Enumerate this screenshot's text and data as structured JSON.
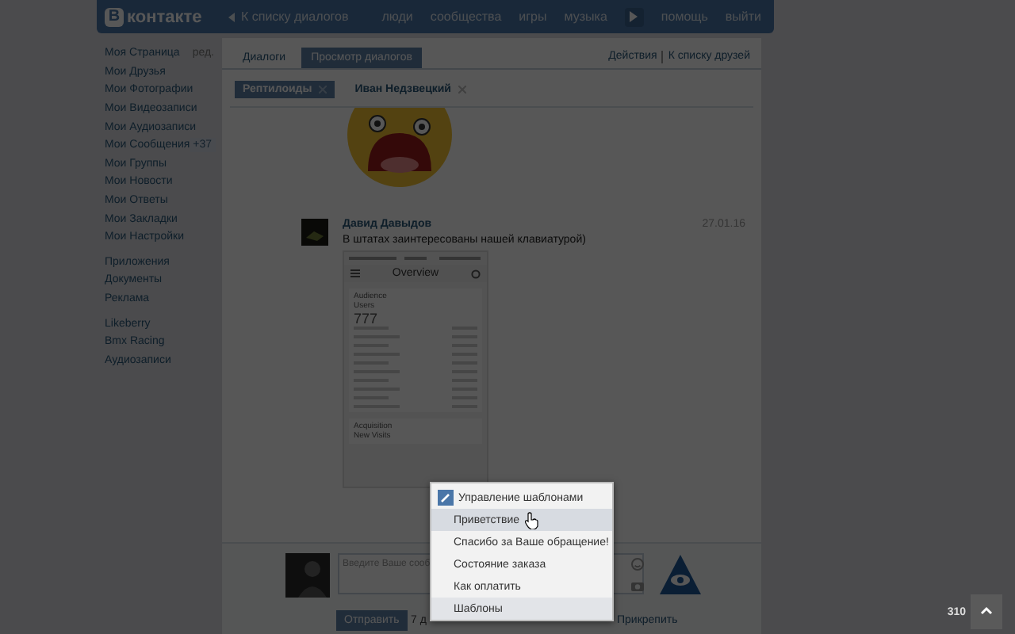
{
  "header": {
    "logo_mark": "В",
    "logo_text": "контакте",
    "back_link": "К списку диалогов",
    "nav": [
      {
        "kind": "link",
        "label": "люди"
      },
      {
        "kind": "link",
        "label": "сообщества"
      },
      {
        "kind": "link",
        "label": "игры"
      },
      {
        "kind": "link",
        "label": "музыка"
      },
      {
        "kind": "player"
      },
      {
        "kind": "link",
        "label": "помощь"
      },
      {
        "kind": "link",
        "label": "выйти"
      }
    ]
  },
  "sidebar": {
    "groups": [
      [
        {
          "label": "Моя Страница",
          "action": "ред."
        },
        {
          "label": "Мои Друзья"
        },
        {
          "label": "Мои Фотографии"
        },
        {
          "label": "Мои Видеозаписи"
        },
        {
          "label": "Мои Аудиозаписи"
        },
        {
          "label": "Мои Сообщения",
          "badge": "+37"
        },
        {
          "label": "Мои Группы"
        },
        {
          "label": "Мои Новости"
        },
        {
          "label": "Мои Ответы"
        },
        {
          "label": "Мои Закладки"
        },
        {
          "label": "Мои Настройки"
        }
      ],
      [
        {
          "label": "Приложения"
        },
        {
          "label": "Документы"
        },
        {
          "label": "Реклама"
        }
      ],
      [
        {
          "label": "Likeberry"
        },
        {
          "label": "Bmx Racing"
        },
        {
          "label": "Аудиозаписи"
        }
      ]
    ]
  },
  "tabs": [
    {
      "label": "Диалоги",
      "selected": false
    },
    {
      "label": "Просмотр диалогов",
      "selected": true
    }
  ],
  "actions": [
    "Действия",
    "К списку друзей"
  ],
  "chats": [
    {
      "label": "Рептилоиды",
      "selected": true
    },
    {
      "label": "Иван Недзвецкий",
      "selected": false
    }
  ],
  "message": {
    "author": "Давид Давыдов",
    "date": "27.01.16",
    "text": "В штатах заинтересованы нашей клавиатурой)",
    "attachment": {
      "title": "Overview",
      "section": "Audience",
      "metric": "Users",
      "value": "777",
      "section_2": "Acquisition",
      "metric_2": "New Visits"
    }
  },
  "composer": {
    "placeholder": "Введите Ваше сооб",
    "send": "Отправить",
    "counter": "7 д",
    "attach": "Прикрепить"
  },
  "menu": [
    {
      "kind": "manage",
      "label": "Управление шаблонами",
      "hovered": false
    },
    {
      "kind": "template",
      "label": "Приветствие",
      "hovered": true
    },
    {
      "kind": "template",
      "label": "Спасибо за Ваше обращение!",
      "hovered": false
    },
    {
      "kind": "template",
      "label": "Состояние заказа",
      "hovered": false
    },
    {
      "kind": "template",
      "label": "Как оплатить",
      "hovered": false
    },
    {
      "kind": "footer",
      "label": "Шаблоны",
      "hovered": false
    }
  ],
  "corner_count": "310"
}
